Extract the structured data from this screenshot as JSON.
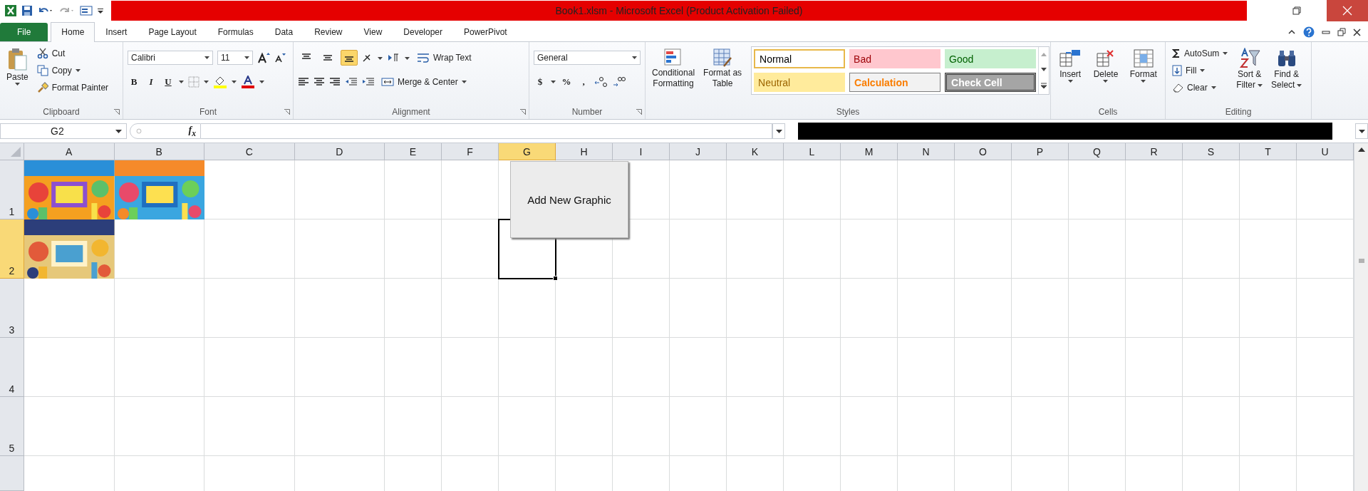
{
  "window": {
    "title": "Book1.xlsm  -  Microsoft Excel (Product Activation Failed)"
  },
  "tabs": [
    {
      "label": "File",
      "kind": "file",
      "selected": false
    },
    {
      "label": "Home",
      "kind": "tab",
      "selected": true
    },
    {
      "label": "Insert",
      "kind": "tab",
      "selected": false
    },
    {
      "label": "Page Layout",
      "kind": "tab",
      "selected": false
    },
    {
      "label": "Formulas",
      "kind": "tab",
      "selected": false
    },
    {
      "label": "Data",
      "kind": "tab",
      "selected": false
    },
    {
      "label": "Review",
      "kind": "tab",
      "selected": false
    },
    {
      "label": "View",
      "kind": "tab",
      "selected": false
    },
    {
      "label": "Developer",
      "kind": "tab",
      "selected": false
    },
    {
      "label": "PowerPivot",
      "kind": "tab",
      "selected": false
    }
  ],
  "clipboard": {
    "paste": "Paste",
    "cut": "Cut",
    "copy": "Copy",
    "format_painter": "Format Painter",
    "group": "Clipboard"
  },
  "font": {
    "name": "Calibri",
    "size": "11",
    "bold": "B",
    "italic": "I",
    "underline": "U",
    "group": "Font"
  },
  "alignment": {
    "valign": [
      {
        "kind": "top",
        "selected": false
      },
      {
        "kind": "middle",
        "selected": false
      },
      {
        "kind": "bottom",
        "selected": true
      }
    ],
    "wrap": "Wrap Text",
    "merge": "Merge & Center",
    "group": "Alignment"
  },
  "number": {
    "format": "General",
    "currency": "$",
    "percent": "%",
    "comma": ",",
    "group": "Number"
  },
  "styles": {
    "conditional": [
      "Conditional",
      "Formatting"
    ],
    "table": [
      "Format as",
      "Table"
    ],
    "gallery": [
      {
        "label": "Normal",
        "kind": "normal"
      },
      {
        "label": "Bad",
        "kind": "bad"
      },
      {
        "label": "Good",
        "kind": "good"
      },
      {
        "label": "Neutral",
        "kind": "neutral"
      },
      {
        "label": "Calculation",
        "kind": "calculation"
      },
      {
        "label": "Check Cell",
        "kind": "check"
      }
    ],
    "group": "Styles"
  },
  "cells": {
    "buttons": [
      {
        "label": "Insert",
        "kind": "insert"
      },
      {
        "label": "Delete",
        "kind": "delete"
      },
      {
        "label": "Format",
        "kind": "format"
      }
    ],
    "group": "Cells"
  },
  "editing": {
    "autosum": "AutoSum",
    "fill": "Fill",
    "clear": "Clear",
    "sort": [
      "Sort &",
      "Filter"
    ],
    "find": [
      "Find &",
      "Select"
    ],
    "group": "Editing"
  },
  "formula_bar": {
    "name_box": "G2",
    "function_label": "f$_{x}$"
  },
  "columns": [
    {
      "label": "A",
      "selected": false
    },
    {
      "label": "B",
      "selected": false
    },
    {
      "label": "C",
      "selected": false
    },
    {
      "label": "D",
      "selected": false
    },
    {
      "label": "E",
      "selected": false
    },
    {
      "label": "F",
      "selected": false
    },
    {
      "label": "G",
      "selected": true
    },
    {
      "label": "H",
      "selected": false
    },
    {
      "label": "I",
      "selected": false
    },
    {
      "label": "J",
      "selected": false
    },
    {
      "label": "K",
      "selected": false
    },
    {
      "label": "L",
      "selected": false
    },
    {
      "label": "M",
      "selected": false
    },
    {
      "label": "N",
      "selected": false
    },
    {
      "label": "O",
      "selected": false
    },
    {
      "label": "P",
      "selected": false
    },
    {
      "label": "Q",
      "selected": false
    },
    {
      "label": "R",
      "selected": false
    },
    {
      "label": "S",
      "selected": false
    },
    {
      "label": "T",
      "selected": false
    },
    {
      "label": "U",
      "selected": false
    }
  ],
  "rows": [
    {
      "label": "1",
      "selected": false
    },
    {
      "label": "2",
      "selected": true
    },
    {
      "label": "3",
      "selected": false
    },
    {
      "label": "4",
      "selected": false
    },
    {
      "label": "5",
      "selected": false
    }
  ],
  "form_button": {
    "label": "Add New Graphic"
  }
}
